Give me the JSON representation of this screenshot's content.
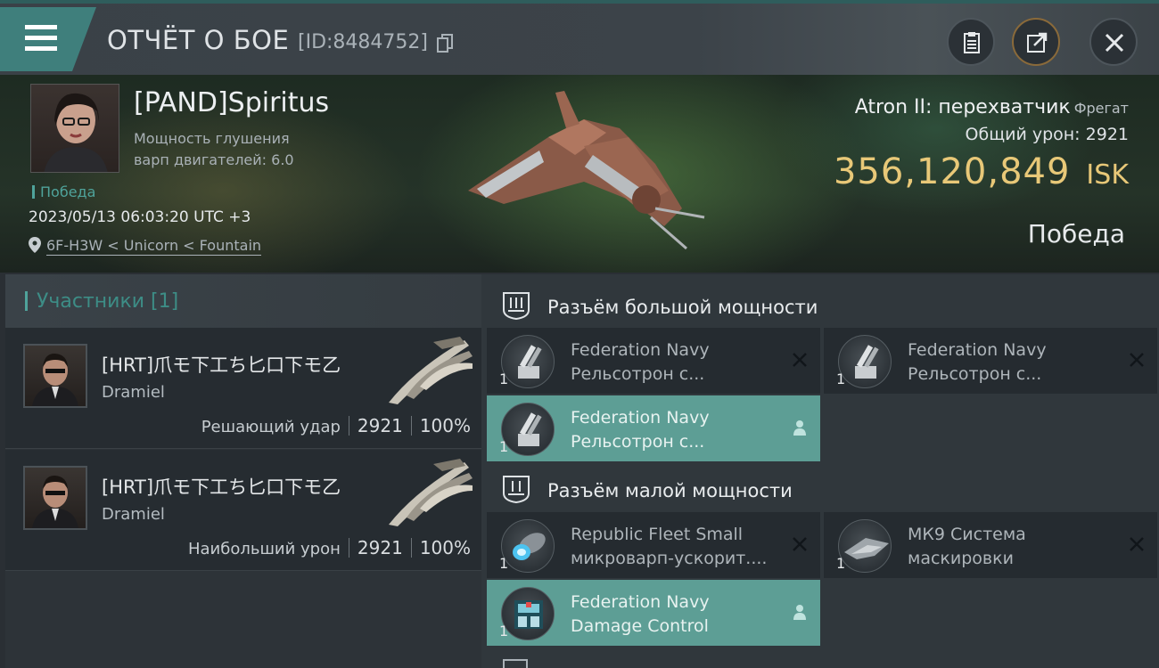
{
  "header": {
    "title": "ОТЧЁТ О БОЕ",
    "report_id": "[ID:8484752]"
  },
  "victim": {
    "pilot_name": "[PAND]Spiritus",
    "stat_line1": "Мощность глушения",
    "stat_line2": "варп двигателей: 6.0",
    "tag": "Победа",
    "datetime": "2023/05/13 06:03:20 UTC +3",
    "location": "6F-H3W < Unicorn < Fountain",
    "ship_name": "Atron II: перехватчик",
    "ship_class": "Фрегат",
    "total_damage_label": "Общий урон:",
    "total_damage": "2921",
    "isk_value": "356,120,849",
    "isk_unit": "ISK",
    "result": "Победа"
  },
  "participants": {
    "title": "Участники [1]",
    "items": [
      {
        "corp_name": "[HRT]爪モ下工ち匕口下モ乙",
        "char_name": "Dramiel",
        "role": "Решающий удар",
        "damage": "2921",
        "percent": "100%"
      },
      {
        "corp_name": "[HRT]爪モ下工ち匕口下モ乙",
        "char_name": "Dramiel",
        "role": "Наибольший урон",
        "damage": "2921",
        "percent": "100%"
      }
    ]
  },
  "fitting": {
    "high_slots": {
      "title": "Разъём большой мощности",
      "modules": [
        {
          "qty": "1",
          "line1": "Federation Navy",
          "line2": "Рельсотрон с...",
          "state": "destroyed",
          "icon": "railgun-icon"
        },
        {
          "qty": "1",
          "line1": "Federation Navy",
          "line2": "Рельсотрон с...",
          "state": "destroyed",
          "icon": "railgun-icon"
        },
        {
          "qty": "1",
          "line1": "Federation Navy",
          "line2": "Рельсотрон с...",
          "state": "dropped",
          "icon": "railgun-icon"
        }
      ]
    },
    "low_slots": {
      "title": "Разъём малой мощности",
      "modules": [
        {
          "qty": "1",
          "line1": "Republic Fleet Small",
          "line2": "микроварп-ускорит....",
          "state": "destroyed",
          "icon": "microwarpdrive-icon"
        },
        {
          "qty": "1",
          "line1": "МК9 Система",
          "line2": "маскировки",
          "state": "destroyed",
          "icon": "cloak-icon"
        },
        {
          "qty": "1",
          "line1": "Federation Navy",
          "line2": "Damage Control",
          "state": "dropped",
          "icon": "damage-control-icon"
        }
      ]
    }
  },
  "colors": {
    "accent_teal": "#4fa39b",
    "isk_gold": "#e8c878",
    "dropped_highlight": "#5d9e95"
  }
}
